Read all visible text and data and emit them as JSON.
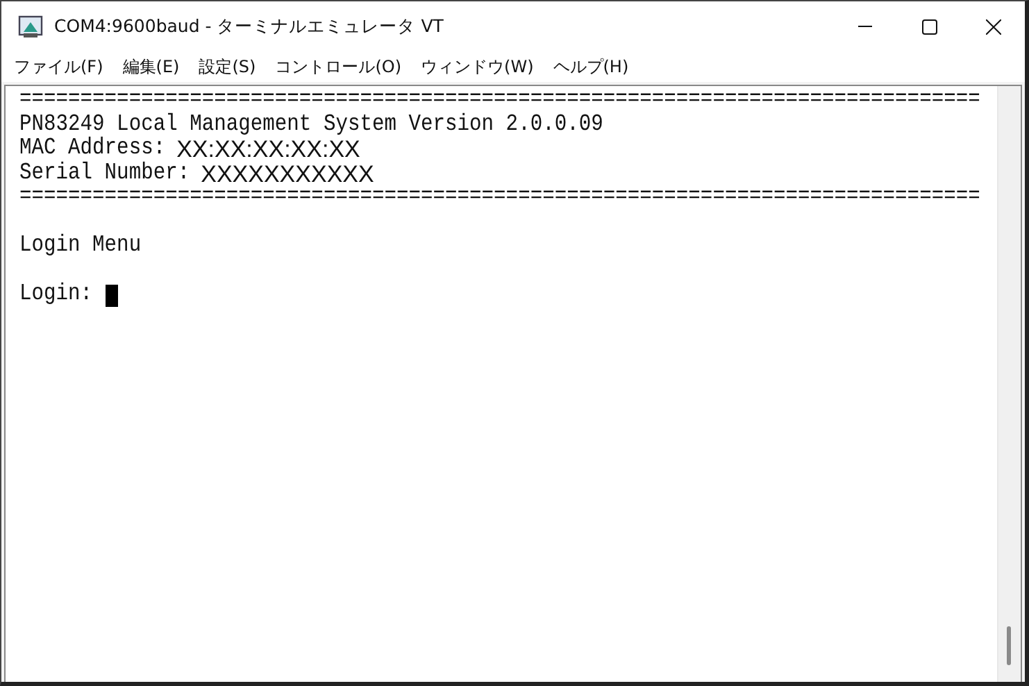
{
  "window": {
    "title": "COM4:9600baud - ターミナルエミュレータ VT"
  },
  "menu": [
    "ファイル(F)",
    "編集(E)",
    "設定(S)",
    "コントロール(O)",
    "ウィンドウ(W)",
    "ヘルプ(H)"
  ],
  "terminal": {
    "lines": [
      {
        "kind": "rule",
        "text": "==============================================================================="
      },
      {
        "kind": "text",
        "text": "PN83249 Local Management System Version 2.0.0.09"
      },
      {
        "kind": "field",
        "label": "MAC Address:",
        "value": "XX:XX:XX:XX:XX"
      },
      {
        "kind": "field",
        "label": "Serial Number:",
        "value": "XXXXXXXXXXX"
      },
      {
        "kind": "rule",
        "text": "==============================================================================="
      },
      {
        "kind": "blank"
      },
      {
        "kind": "text",
        "text": "Login Menu"
      },
      {
        "kind": "blank"
      },
      {
        "kind": "prompt",
        "text": "Login:"
      }
    ]
  }
}
